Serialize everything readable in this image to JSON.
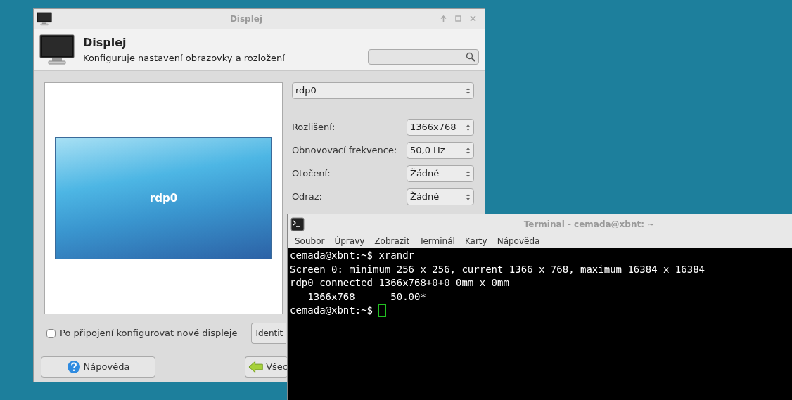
{
  "display_window": {
    "title": "Displej",
    "header": {
      "title": "Displej",
      "subtitle": "Konfiguruje nastavení obrazovky a rozložení"
    },
    "preview": {
      "monitor_label": "rdp0"
    },
    "output_select": "rdp0",
    "settings": [
      {
        "label": "Rozlišení:",
        "value": "1366x768"
      },
      {
        "label": "Obnovovací frekvence:",
        "value": "50,0 Hz"
      },
      {
        "label": "Otočení:",
        "value": "Žádné"
      },
      {
        "label": "Odraz:",
        "value": "Žádné"
      }
    ],
    "auto_configure": {
      "label": "Po připojení konfigurovat nové displeje",
      "checked": false
    },
    "identify_button": "Identit",
    "help_button": "Nápověda",
    "all_button": "Všec"
  },
  "terminal": {
    "title": "Terminal - cemada@xbnt: ~",
    "menu": [
      "Soubor",
      "Úpravy",
      "Zobrazit",
      "Terminál",
      "Karty",
      "Nápověda"
    ],
    "lines": [
      "cemada@xbnt:~$ xrandr",
      "Screen 0: minimum 256 x 256, current 1366 x 768, maximum 16384 x 16384",
      "rdp0 connected 1366x768+0+0 0mm x 0mm",
      "   1366x768      50.00*",
      "cemada@xbnt:~$ "
    ]
  }
}
